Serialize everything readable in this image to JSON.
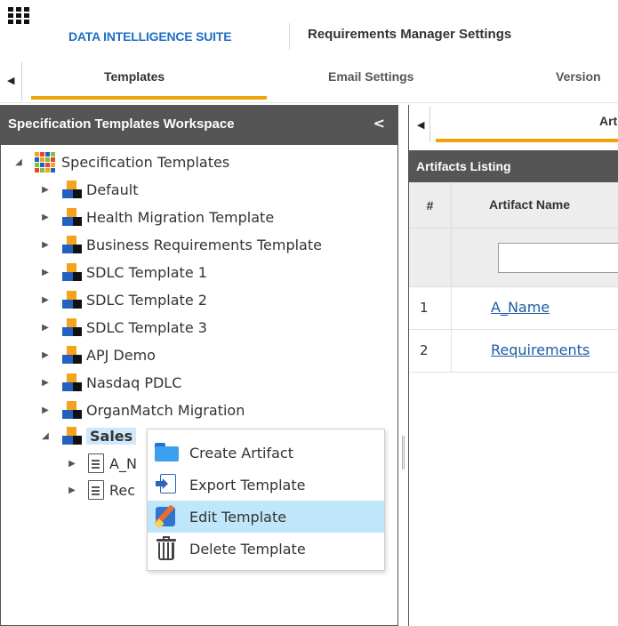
{
  "header": {
    "brand": "DATA INTELLIGENCE SUITE",
    "page_title": "Requirements Manager Settings",
    "app_grid_icon": "app-launcher-grid-icon"
  },
  "tabs": [
    {
      "label": "Templates",
      "active": true
    },
    {
      "label": "Email Settings",
      "active": false
    },
    {
      "label": "Version",
      "active": false
    }
  ],
  "accent_color": "#f0a30a",
  "left_panel": {
    "title": "Specification Templates Workspace",
    "collapse_glyph": "<",
    "tree": {
      "root": "Specification Templates",
      "templates": [
        "Default",
        "Health Migration Template",
        "Business Requirements Template",
        "SDLC Template 1",
        "SDLC Template 2",
        "SDLC Template 3",
        "APJ Demo",
        "Nasdaq PDLC",
        "OrganMatch Migration",
        "Sales"
      ],
      "selected": "Sales",
      "sales_children": [
        "A_N",
        "Rec"
      ]
    }
  },
  "context_menu": {
    "items": [
      {
        "label": "Create Artifact",
        "icon": "folder-icon"
      },
      {
        "label": "Export Template",
        "icon": "export-icon"
      },
      {
        "label": "Edit Template",
        "icon": "edit-icon",
        "highlighted": true
      },
      {
        "label": "Delete Template",
        "icon": "trash-icon"
      }
    ]
  },
  "right_panel": {
    "tab_label": "Artifa",
    "listing_title": "Artifacts Listing",
    "columns": [
      "#",
      "Artifact Name"
    ],
    "filter_value": "",
    "rows": [
      {
        "num": "1",
        "name": "A_Name"
      },
      {
        "num": "2",
        "name": "Requirements"
      }
    ]
  }
}
